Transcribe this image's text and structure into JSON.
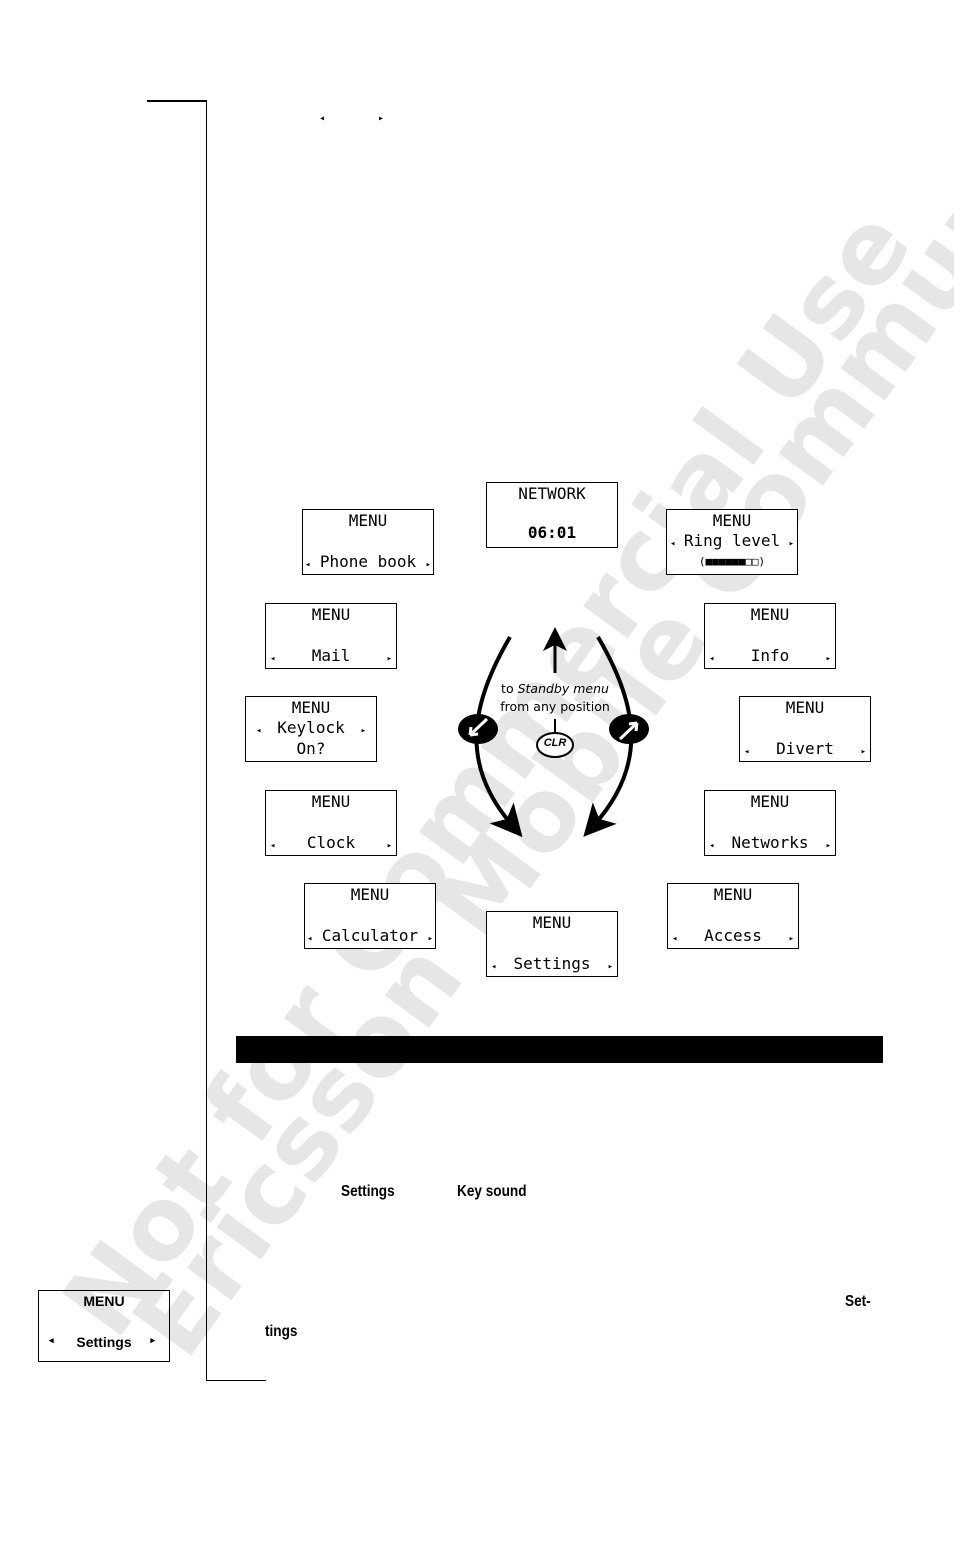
{
  "watermark": {
    "line1": "Not for Commercial Use",
    "line2": "Ericsson Mobile Communications AB",
    "color": "#e6e6e6"
  },
  "top_nav_glyphs": {
    "left": "left-arrow-key-icon",
    "right": "right-arrow-key-icon",
    "left_char": "◂",
    "right_char": "▸"
  },
  "menu_diagram": {
    "standby": {
      "line1": "NETWORK",
      "line2": "06:01"
    },
    "screens": [
      {
        "id": "phone-book",
        "title": "MENU",
        "item": "Phone book"
      },
      {
        "id": "ring-level",
        "title": "MENU",
        "item": "Ring level",
        "level_filled": 6,
        "level_total": 8,
        "level_display": "(■■■■■■□□)"
      },
      {
        "id": "mail",
        "title": "MENU",
        "item": "Mail"
      },
      {
        "id": "info",
        "title": "MENU",
        "item": "Info"
      },
      {
        "id": "keylock",
        "title": "MENU",
        "item": "Keylock",
        "sub": "On?"
      },
      {
        "id": "divert",
        "title": "MENU",
        "item": "Divert"
      },
      {
        "id": "clock",
        "title": "MENU",
        "item": "Clock"
      },
      {
        "id": "networks",
        "title": "MENU",
        "item": "Networks"
      },
      {
        "id": "calculator",
        "title": "MENU",
        "item": "Calculator"
      },
      {
        "id": "access",
        "title": "MENU",
        "item": "Access"
      },
      {
        "id": "settings",
        "title": "MENU",
        "item": "Settings"
      }
    ],
    "arrow_left_char": "◂",
    "arrow_right_char": "▸",
    "caption_prefix": "to ",
    "caption_italic": "Standby menu",
    "caption_line2": "from any position",
    "clr_key": "CLR"
  },
  "body_text": {
    "menu_ref_1": "Settings",
    "menu_ref_2": "Key sound",
    "menu_ref_3_part1": "Set-",
    "menu_ref_3_part2": "tings"
  },
  "sidebar_screen": {
    "title": "MENU",
    "item": "Settings",
    "arrow_left": "◂",
    "arrow_right": "▸"
  }
}
